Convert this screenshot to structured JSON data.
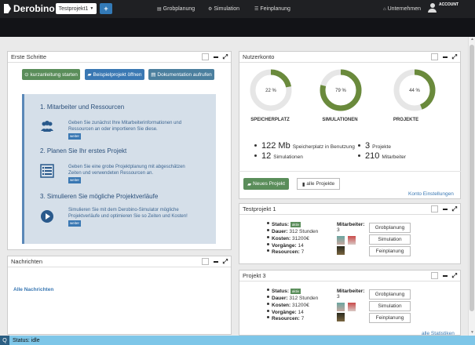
{
  "header": {
    "logo_text": "Derobino",
    "project_select": "Testprojekt1",
    "add_symbol": "+",
    "nav": [
      {
        "icon": "chart-icon",
        "label": "Grobplanung"
      },
      {
        "icon": "gear-icon",
        "label": "Simulation"
      },
      {
        "icon": "list-icon",
        "label": "Feinplanung"
      },
      {
        "icon": "home-icon",
        "label": "Unternehmen"
      }
    ],
    "account_label": "ACCOUNT"
  },
  "erste_schritte": {
    "title": "Erste Schritte",
    "btn_tutorial": "kurzanleitung starten",
    "btn_example": "Beispielprojekt öffnen",
    "btn_docs": "Dokumentation aufrufen",
    "steps": [
      {
        "title": "1. Mitarbeiter und Ressourcen",
        "text": "Geben Sie zunächst Ihre Mitarbeiterinformationen und Ressourcen an oder importieren Sie diese.",
        "more": "weiter"
      },
      {
        "title": "2. Planen Sie Ihr erstes Projekt",
        "text": "Geben Sie eine grobe Projektplanung mit abgeschätzen Zeiten und verwendeten Ressourcen an.",
        "more": "weiter"
      },
      {
        "title": "3. Simulieren Sie mögliche Projektverläufe",
        "text": "Simulieren Sie mit dem Derobino-Simulator mögliche Projektverläufe und optimieren Sie so Zeiten und Kosten!",
        "more": "weiter"
      }
    ]
  },
  "nachrichten": {
    "title": "Nachrichten",
    "all_link": "Alle Nachrichten"
  },
  "nutzerkonto": {
    "title": "Nutzerkonto",
    "donuts": [
      {
        "label": "SPEICHERPLATZ",
        "value_text": "22 %",
        "percent": 22
      },
      {
        "label": "SIMULATIONEN",
        "value_text": "79 %",
        "percent": 79
      },
      {
        "label": "PROJEKTE",
        "value_text": "44 %",
        "percent": 44
      }
    ],
    "stats": [
      {
        "value": "122 Mb",
        "label": "Speicherplatz in Benutzung"
      },
      {
        "value": "3",
        "label": "Projekte"
      },
      {
        "value": "12",
        "label": "Simulationen"
      },
      {
        "value": "210",
        "label": "Mitarbeiter"
      }
    ],
    "btn_new_project": "Neues Projekt",
    "btn_all_projects": "alle Projekte",
    "settings_link": "Konto Einstellungen"
  },
  "projects": [
    {
      "title": "Testprojekt 1",
      "status_label": "Status:",
      "status_badge": "aktiv",
      "dauer_label": "Dauer:",
      "dauer_value": "312 Stunden",
      "kosten_label": "Kosten:",
      "kosten_value": "31200€",
      "vorgaenge_label": "Vorgänge:",
      "vorgaenge_value": "14",
      "ressourcen_label": "Resourcen:",
      "ressourcen_value": "7",
      "mitarbeiter_label": "Mitarbeiter:",
      "mitarbeiter_count": "3",
      "btn_grob": "Grobplanung",
      "btn_sim": "Simulation",
      "btn_fein": "Feinplanung"
    },
    {
      "title": "Projekt 3",
      "status_label": "Status:",
      "status_badge": "aktiv",
      "dauer_label": "Dauer:",
      "dauer_value": "312 Stunden",
      "kosten_label": "Kosten:",
      "kosten_value": "31200€",
      "vorgaenge_label": "Vorgänge:",
      "vorgaenge_value": "14",
      "ressourcen_label": "Resourcen:",
      "ressourcen_value": "7",
      "mitarbeiter_label": "Mitarbeiter:",
      "mitarbeiter_count": "3",
      "btn_grob": "Grobplanung",
      "btn_sim": "Simulation",
      "btn_fein": "Feinplanung"
    }
  ],
  "all_stats_link": "alle Statistiken",
  "statusbar": {
    "search_symbol": "Q",
    "text": "Status: idle"
  },
  "colors": {
    "donut_fill": "#6a8a3c",
    "donut_track": "#e6e6e6",
    "accent_blue": "#3a78b3",
    "green_button": "#5a8d5a",
    "statusbar": "#7ec6e8"
  }
}
